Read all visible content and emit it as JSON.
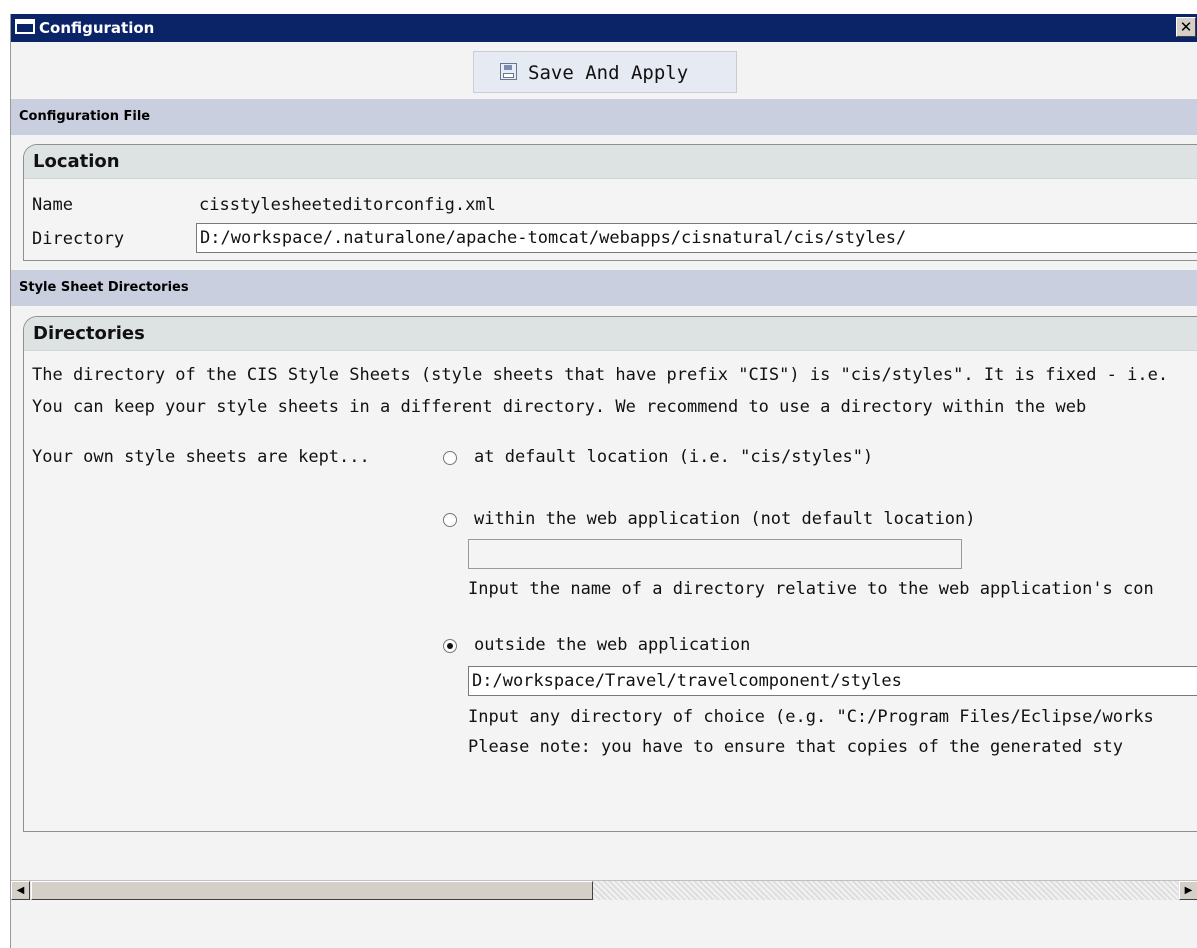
{
  "window": {
    "title": "Configuration",
    "close_label": "✕"
  },
  "toolbar": {
    "save_label": "Save And Apply",
    "save_icon": "floppy-disk-icon"
  },
  "config_file": {
    "section_title": "Configuration File",
    "group_title": "Location",
    "name_label": "Name",
    "name_value": "cisstylesheeteditorconfig.xml",
    "directory_label": "Directory",
    "directory_value": "D:/workspace/.naturalone/apache-tomcat/webapps/cisnatural/cis/styles/"
  },
  "style_sheets": {
    "section_title": "Style Sheet Directories",
    "group_title": "Directories",
    "desc_line1": "The directory of the CIS Style Sheets (style sheets that have prefix \"CIS\") is \"cis/styles\". It is fixed - i.e.",
    "desc_line2": "You can keep your style sheets in a different directory. We recommend to use a directory within the web",
    "kept_label": "Your own style sheets are kept...",
    "option_default": "at  default location (i.e. \"cis/styles\")",
    "option_within": "within the web application (not default location)",
    "within_value": "",
    "within_hint": "Input the name of a directory relative to the web application's con",
    "option_outside": "outside the web application",
    "outside_value": "D:/workspace/Travel/travelcomponent/styles",
    "outside_hint1": "Input any directory of choice (e.g. \"C:/Program Files/Eclipse/works",
    "outside_hint2": "Please note: you have to ensure that copies of the generated sty",
    "selected_option": "outside"
  },
  "scrollbar": {
    "left_arrow": "◀",
    "right_arrow": "▶"
  },
  "colors": {
    "titlebar": "#0b2467",
    "section_header": "#c9cfdf",
    "group_title": "#dde3e3"
  }
}
